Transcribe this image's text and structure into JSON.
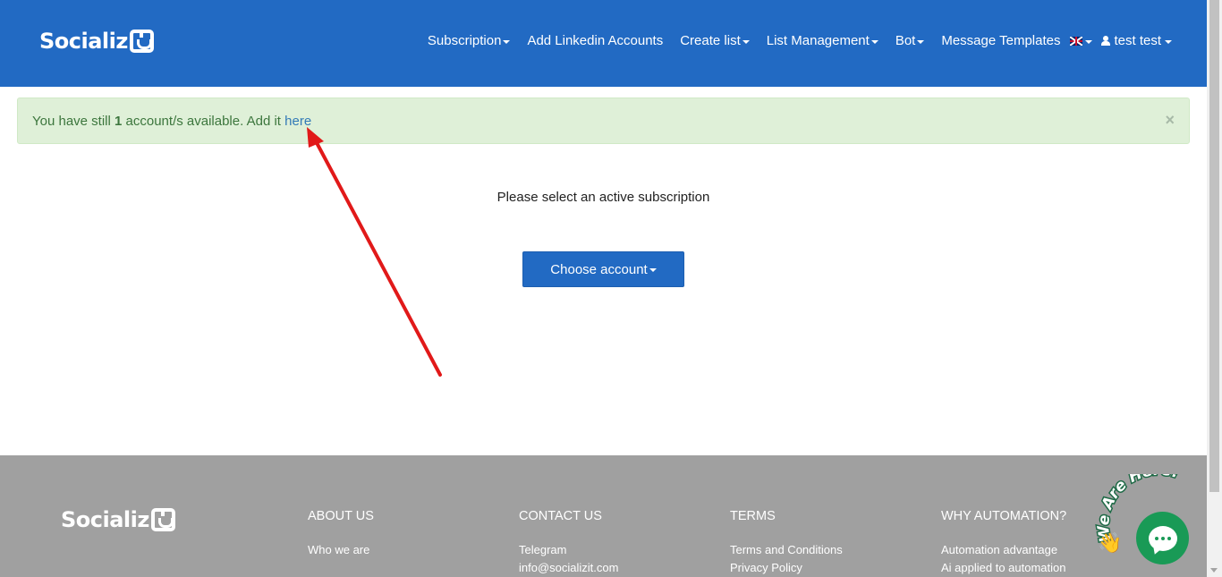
{
  "header": {
    "logo_text": "Socializ",
    "nav": {
      "subscription": "Subscription",
      "add_linkedin": "Add Linkedin Accounts",
      "create_list": "Create list",
      "list_management": "List Management",
      "bot": "Bot",
      "message_templates": "Message Templates",
      "user": "test test"
    },
    "icons": [
      "uk-flag-icon",
      "user-icon",
      "caret-down-icon"
    ]
  },
  "alert": {
    "prefix": "You have still ",
    "count": "1",
    "middle": " account/s available. Add it ",
    "link": "here",
    "close": "×"
  },
  "main": {
    "prompt": "Please select an active subscription",
    "choose_button": "Choose account"
  },
  "footer": {
    "logo_text": "Socializ",
    "about": {
      "heading": "ABOUT US",
      "links": [
        "Who we are"
      ]
    },
    "contact": {
      "heading": "CONTACT US",
      "links": [
        "Telegram",
        "info@socializit.com"
      ]
    },
    "terms": {
      "heading": "TERMS",
      "links": [
        "Terms and Conditions",
        "Privacy Policy"
      ]
    },
    "why": {
      "heading": "WHY AUTOMATION?",
      "links": [
        "Automation advantage",
        "Ai applied to automation"
      ]
    }
  },
  "chat": {
    "badge_text": "We Are Here!",
    "icon": "chat-bubble-icon"
  },
  "colors": {
    "primary": "#226ac3",
    "alert_bg": "#dff0d8",
    "alert_text": "#3c763d",
    "link": "#337ab7",
    "footer_bg": "#a0a0a0",
    "chat_green": "#199a56",
    "annotation_arrow": "#e11919"
  }
}
